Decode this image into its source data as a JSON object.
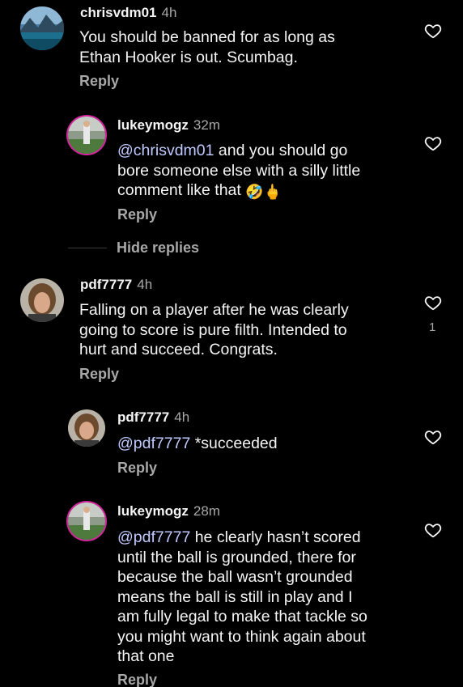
{
  "comments": [
    {
      "username": "chrisvdm01",
      "time": "4h",
      "lines": [
        "You should be banned for as long as",
        "Ethan Hooker is out. Scumbag."
      ],
      "reply_label": "Reply"
    },
    {
      "username": "lukeymogz",
      "time": "32m",
      "mention": "@chrisvdm01",
      "lines": [
        " and you should go",
        "bore someone else with a silly little",
        "comment like that "
      ],
      "emojis": [
        "🤣",
        "🖕"
      ],
      "reply_label": "Reply",
      "hide_replies_label": "Hide replies"
    },
    {
      "username": "pdf7777",
      "time": "4h",
      "lines": [
        "Falling on a player after he was clearly",
        "going to score is pure filth. Intended to",
        "hurt and succeed. Congrats."
      ],
      "likes": "1",
      "reply_label": "Reply"
    },
    {
      "username": "pdf7777",
      "time": "4h",
      "mention": "@pdf7777",
      "lines": [
        " *succeeded"
      ],
      "reply_label": "Reply"
    },
    {
      "username": "lukeymogz",
      "time": "28m",
      "mention": "@pdf7777",
      "lines": [
        " he clearly hasn’t scored",
        "until the ball is grounded, there for",
        "because the ball wasn’t grounded",
        "means the ball is still in play and I",
        "am fully legal to make that tackle so",
        "you might want to think again about",
        "that one"
      ],
      "reply_label": "Reply"
    }
  ],
  "icons": {
    "like": "heart-outline-icon"
  },
  "colors": {
    "background": "#000000",
    "text": "#f5f5f5",
    "secondary": "#a8a8a8",
    "mention": "#c0c9ff"
  }
}
